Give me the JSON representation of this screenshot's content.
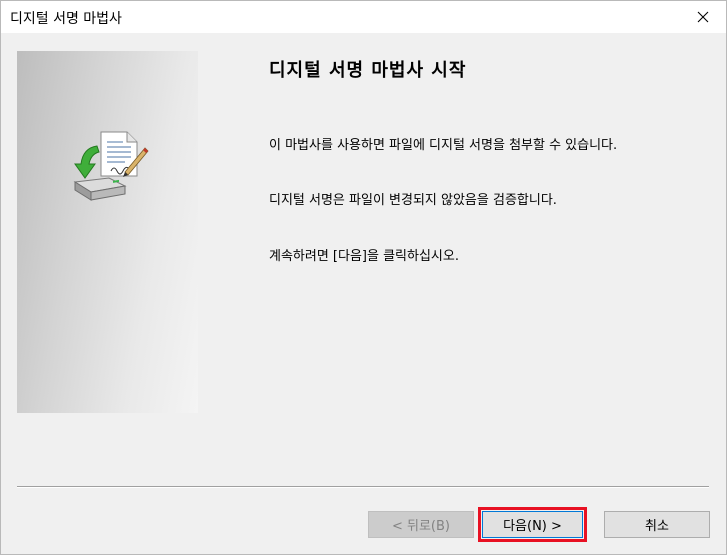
{
  "window": {
    "title": "디지털 서명 마법사"
  },
  "content": {
    "heading": "디지털 서명 마법사 시작",
    "paragraph1": "이 마법사를 사용하면 파일에 디지털 서명을 첨부할 수 있습니다.",
    "paragraph2": "디지털 서명은 파일이 변경되지 않았음을 검증합니다.",
    "paragraph3": "계속하려면 [다음]을 클릭하십시오."
  },
  "buttons": {
    "back_label": "< 뒤로(B)",
    "next_label": "다음(N) >",
    "cancel_label": "취소"
  },
  "icons": {
    "close": "close-icon",
    "wizard": "document-sign-icon"
  },
  "colors": {
    "highlight": "#e81123",
    "focus": "#0078d7",
    "face": "#f0f0f0"
  }
}
